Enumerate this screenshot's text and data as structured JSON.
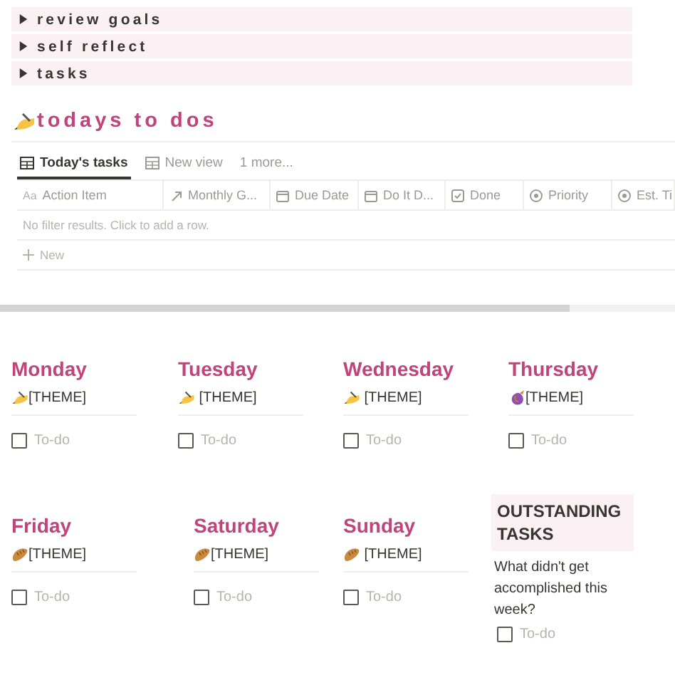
{
  "toggles": [
    {
      "label": "review goals",
      "expanded": false
    },
    {
      "label": "self reflect",
      "expanded": false
    },
    {
      "label": "tasks",
      "expanded": false
    }
  ],
  "heading": {
    "text": "todays to dos"
  },
  "views": [
    {
      "label": "Today's tasks",
      "selected": true,
      "kind": "table"
    },
    {
      "label": "New view",
      "selected": false,
      "kind": "table"
    },
    {
      "label": "1 more...",
      "selected": false,
      "kind": "more"
    }
  ],
  "table": {
    "columns": [
      {
        "label": "Action Item",
        "kind": "title",
        "prefix": "Aa"
      },
      {
        "label": "Monthly G...",
        "kind": "relation"
      },
      {
        "label": "Due Date",
        "kind": "date"
      },
      {
        "label": "Do It D...",
        "kind": "date"
      },
      {
        "label": "Done",
        "kind": "checkbox"
      },
      {
        "label": "Priority",
        "kind": "select"
      },
      {
        "label": "Est. Ti",
        "kind": "select"
      }
    ],
    "empty_message": "No filter results. Click to add a row.",
    "new_label": "New"
  },
  "days": [
    {
      "name": "Monday",
      "theme": "[THEME]",
      "kind": "hand",
      "todo": "To-do",
      "checked": false
    },
    {
      "name": "Tuesday",
      "theme": " [THEME]",
      "kind": "hand",
      "todo": "To-do",
      "checked": false
    },
    {
      "name": "Wednesday",
      "theme": " [THEME]",
      "kind": "hand",
      "todo": "To-do",
      "checked": false
    },
    {
      "name": "Thursday",
      "theme": "[THEME]",
      "kind": "eggplant",
      "todo": "To-do",
      "checked": false
    },
    {
      "name": "Friday",
      "theme": "[THEME]",
      "kind": "bread",
      "todo": "To-do",
      "checked": false
    },
    {
      "name": "Saturday",
      "theme": "[THEME]",
      "kind": "bread",
      "todo": "To-do",
      "checked": false
    },
    {
      "name": "Sunday",
      "theme": " [THEME]",
      "kind": "bread",
      "todo": "To-do",
      "checked": false
    }
  ],
  "outstanding": {
    "title": "OUTSTANDING TASKS",
    "question": "What didn't get accomplished this week?",
    "todo": "To-do",
    "checked": false
  }
}
